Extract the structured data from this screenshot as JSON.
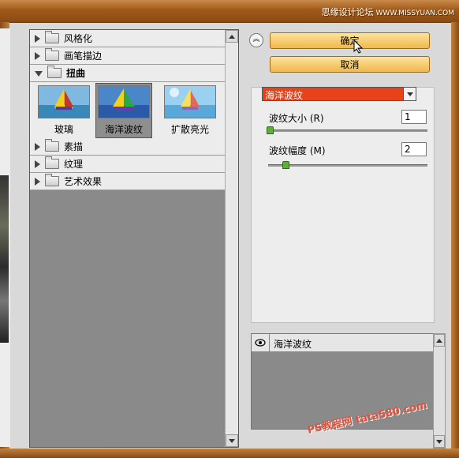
{
  "watermark": {
    "top_text": "思缘设计论坛",
    "top_site": "WWW.MISSYUAN.COM",
    "bottom_text": "PS教程网 tata580.com"
  },
  "gallery": {
    "categories_top": [
      {
        "label": "风格化",
        "expanded": false
      },
      {
        "label": "画笔描边",
        "expanded": false
      },
      {
        "label": "扭曲",
        "expanded": true
      }
    ],
    "thumbnails": [
      {
        "label": "玻璃",
        "selected": false
      },
      {
        "label": "海洋波纹",
        "selected": true
      },
      {
        "label": "扩散亮光",
        "selected": false
      }
    ],
    "categories_bottom": [
      {
        "label": "素描",
        "expanded": false
      },
      {
        "label": "纹理",
        "expanded": false
      },
      {
        "label": "艺术效果",
        "expanded": false
      }
    ]
  },
  "buttons": {
    "ok": "确定",
    "cancel": "取消"
  },
  "settings": {
    "filter_select": "海洋波纹",
    "params": [
      {
        "label": "波纹大小 (R)",
        "value": "1",
        "level": 0.0
      },
      {
        "label": "波纹幅度 (M)",
        "value": "2",
        "level": 0.1
      }
    ]
  },
  "layers": {
    "items": [
      {
        "name": "海洋波纹",
        "visible": true
      }
    ]
  },
  "colors": {
    "accent_select": "#e8421a",
    "button": "#f0b84a",
    "title_bar": "#a05a18"
  }
}
